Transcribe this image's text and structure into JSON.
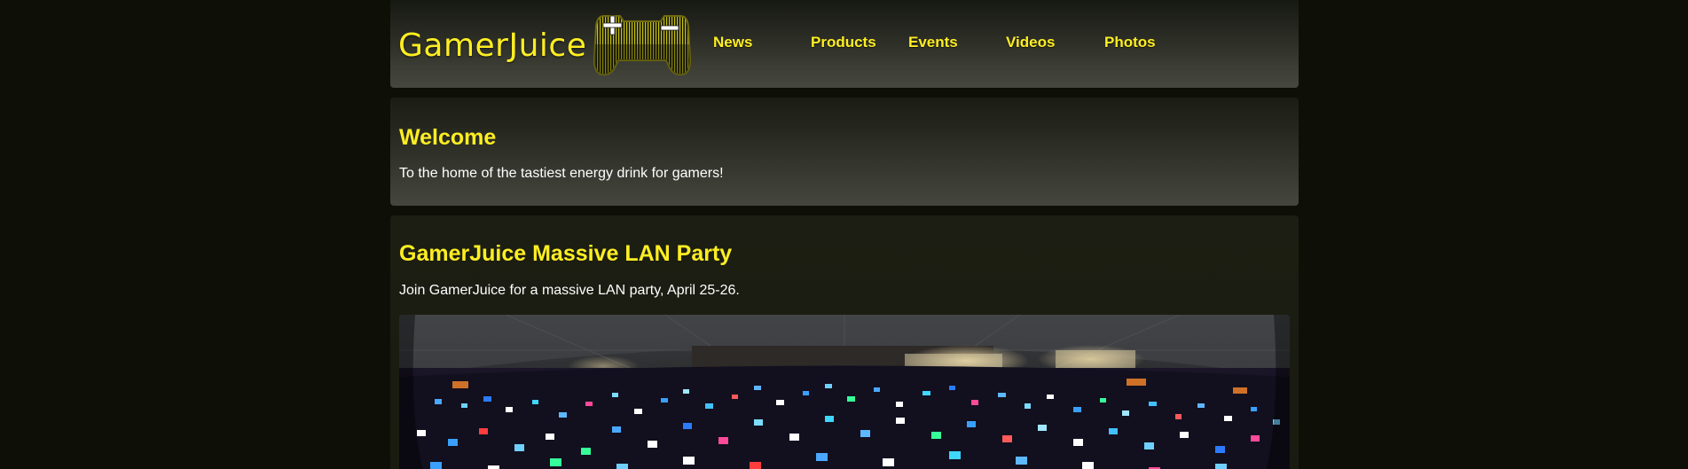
{
  "site": {
    "logo_text": "GamerJuice",
    "accent_color": "#ffee22",
    "background_color": "#0e1008"
  },
  "nav": {
    "items": [
      {
        "label": "News"
      },
      {
        "label": "Products"
      },
      {
        "label": "Events"
      },
      {
        "label": "Videos"
      },
      {
        "label": "Photos"
      }
    ]
  },
  "welcome": {
    "title": "Welcome",
    "text": "To the home of the tastiest energy drink for gamers!"
  },
  "event": {
    "title": "GamerJuice Massive LAN Party",
    "text": "Join GamerJuice for a massive LAN party, April 25-26.",
    "image_icon": "lan-party-photo"
  },
  "icons": {
    "logo_icon": "game-controller-icon"
  }
}
